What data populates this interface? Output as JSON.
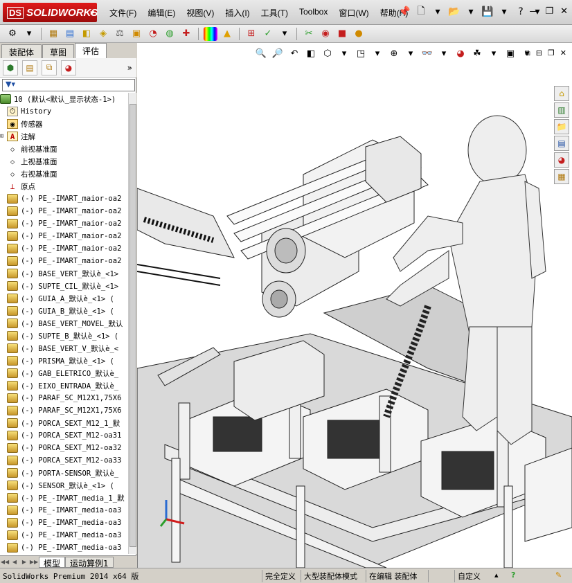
{
  "app": {
    "logo": "SOLIDWORKS",
    "logo_ds": "DS"
  },
  "menu": [
    "文件(F)",
    "编辑(E)",
    "视图(V)",
    "插入(I)",
    "工具(T)",
    "Toolbox",
    "窗口(W)",
    "帮助(H)"
  ],
  "left_panel": {
    "tabs": [
      "装配体",
      "草图",
      "评估"
    ],
    "active_tab": "评估",
    "tree_root": "10  (默认<默认_显示状态-1>)",
    "tree_items": [
      {
        "label": "History",
        "icon": "history-icon"
      },
      {
        "label": "传感器",
        "icon": "sensor-icon"
      },
      {
        "label": "注解",
        "icon": "annotation-icon",
        "expandable": true
      },
      {
        "label": "前视基准面",
        "icon": "plane-icon"
      },
      {
        "label": "上视基准面",
        "icon": "plane-icon"
      },
      {
        "label": "右视基准面",
        "icon": "plane-icon"
      },
      {
        "label": "原点",
        "icon": "origin-icon"
      },
      {
        "label": "(-) PE_-IMART_maior-oa2",
        "icon": "part-icon"
      },
      {
        "label": "(-) PE_-IMART_maior-oa2",
        "icon": "part-icon"
      },
      {
        "label": "(-) PE_-IMART_maior-oa2",
        "icon": "part-icon"
      },
      {
        "label": "(-) PE_-IMART_maior-oa2",
        "icon": "part-icon"
      },
      {
        "label": "(-) PE_-IMART_maior-oa2",
        "icon": "part-icon"
      },
      {
        "label": "(-) PE_-IMART_maior-oa2",
        "icon": "part-icon"
      },
      {
        "label": "(-) BASE_VERT_默认è_<1>",
        "icon": "part-icon"
      },
      {
        "label": "(-) SUPTE_CIL_默认è_<1>",
        "icon": "part-icon"
      },
      {
        "label": "(-) GUIA_A_默认è_<1> (",
        "icon": "part-icon"
      },
      {
        "label": "(-) GUIA_B_默认è_<1> (",
        "icon": "part-icon"
      },
      {
        "label": "(-) BASE_VERT_MOVEL_默认",
        "icon": "part-icon"
      },
      {
        "label": "(-) SUPTE_B_默认è_<1> (",
        "icon": "part-icon"
      },
      {
        "label": "(-) BASE_VERT_V_默认è_<",
        "icon": "part-icon"
      },
      {
        "label": "(-) PRISMA_默认è_<1> (",
        "icon": "part-icon"
      },
      {
        "label": "(-) GAB_ELETRICO_默认è_",
        "icon": "part-icon"
      },
      {
        "label": "(-) EIXO_ENTRADA_默认è_",
        "icon": "part-icon"
      },
      {
        "label": "(-) PARAF_SC_M12X1,75X6",
        "icon": "part-icon"
      },
      {
        "label": "(-) PARAF_SC_M12X1,75X6",
        "icon": "part-icon"
      },
      {
        "label": "(-) PORCA_SEXT_M12_1_默",
        "icon": "part-icon"
      },
      {
        "label": "(-) PORCA_SEXT_M12-oa31",
        "icon": "part-icon"
      },
      {
        "label": "(-) PORCA_SEXT_M12-oa32",
        "icon": "part-icon"
      },
      {
        "label": "(-) PORCA_SEXT_M12-oa33",
        "icon": "part-icon"
      },
      {
        "label": "(-) PORTA-SENSOR_默认è_",
        "icon": "part-icon"
      },
      {
        "label": "(-) SENSOR_默认è_<1> (",
        "icon": "part-icon"
      },
      {
        "label": "(-) PE_-IMART_media_1_默",
        "icon": "part-icon"
      },
      {
        "label": "(-) PE_-IMART_media-oa3",
        "icon": "part-icon"
      },
      {
        "label": "(-) PE_-IMART_media-oa3",
        "icon": "part-icon"
      },
      {
        "label": "(-) PE_-IMART_media-oa3",
        "icon": "part-icon"
      },
      {
        "label": "(-) PE_-IMART_media-oa3",
        "icon": "part-icon"
      }
    ],
    "bottom_tabs": [
      "模型",
      "运动算例1"
    ],
    "active_bottom_tab": "模型"
  },
  "statusbar": {
    "app": "SolidWorks Premium 2014 x64 版",
    "cells": [
      "完全定义",
      "大型装配体模式",
      "在编辑 装配体",
      "",
      "自定义"
    ]
  },
  "colors": {
    "accent": "#c41e1e",
    "panel": "#d4d0c8"
  }
}
